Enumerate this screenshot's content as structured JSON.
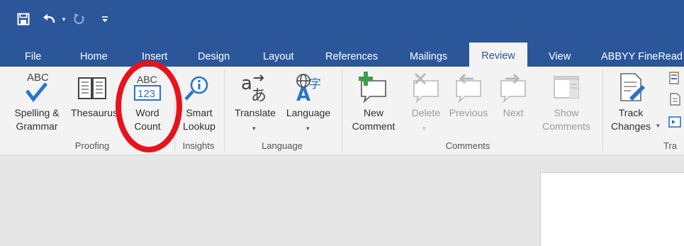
{
  "qat": {
    "save_icon": "floppy-disk-icon",
    "undo_icon": "undo-arrow-icon",
    "redo_icon": "redo-arrow-icon",
    "customize_icon": "customize-qat-icon"
  },
  "tabs": [
    {
      "label": "File"
    },
    {
      "label": "Home"
    },
    {
      "label": "Insert"
    },
    {
      "label": "Design"
    },
    {
      "label": "Layout"
    },
    {
      "label": "References"
    },
    {
      "label": "Mailings"
    },
    {
      "label": "Review",
      "active": true
    },
    {
      "label": "View"
    },
    {
      "label": "ABBYY FineRead"
    }
  ],
  "proofing": {
    "group_label": "Proofing",
    "spelling": {
      "line1": "Spelling &",
      "line2": "Grammar",
      "icon_text": "ABC"
    },
    "thesaurus": {
      "line1": "Thesaurus"
    },
    "word_count": {
      "line1": "Word",
      "line2": "Count",
      "icon_top": "ABC",
      "icon_bottom": "123"
    }
  },
  "insights": {
    "group_label": "Insights",
    "smart_lookup": {
      "line1": "Smart",
      "line2": "Lookup"
    }
  },
  "language": {
    "group_label": "Language",
    "translate": {
      "line1": "Translate"
    },
    "language": {
      "line1": "Language"
    }
  },
  "comments": {
    "group_label": "Comments",
    "new": {
      "line1": "New",
      "line2": "Comment"
    },
    "delete": {
      "line1": "Delete"
    },
    "previous": {
      "line1": "Previous"
    },
    "next": {
      "line1": "Next"
    },
    "show": {
      "line1": "Show",
      "line2": "Comments"
    }
  },
  "tracking": {
    "group_label": "Tra",
    "track_changes": {
      "line1": "Track",
      "line2": "Changes"
    }
  },
  "annotation": {
    "color": "#E8121B"
  },
  "colors": {
    "accent": "#2B579A",
    "ribbon": "#F3F3F3",
    "doc_bg": "#E6E6E6"
  }
}
